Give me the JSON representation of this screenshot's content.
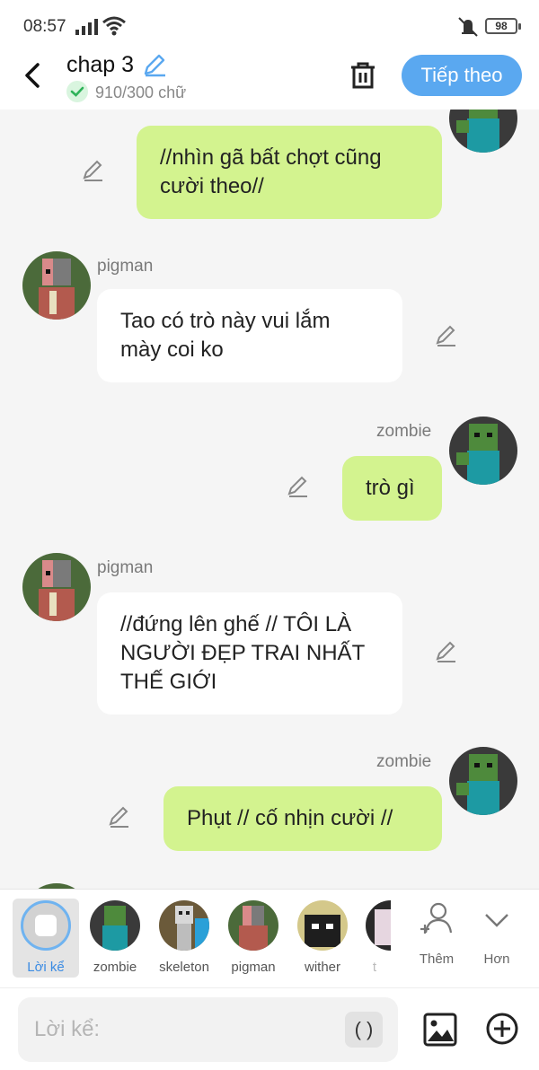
{
  "status_bar": {
    "time": "08:57",
    "battery": "98"
  },
  "header": {
    "title": "chap 3",
    "word_count": "910/300 chữ",
    "next_label": "Tiếp theo"
  },
  "messages": [
    {
      "side": "right",
      "sender": "",
      "text_lines": [
        "//nhìn gã bất chợt cũng",
        "cười theo//"
      ]
    },
    {
      "side": "left",
      "sender": "pigman",
      "text_lines": [
        "Tao có trò này vui lắm",
        "mày coi ko"
      ]
    },
    {
      "side": "right",
      "sender": "zombie",
      "text_lines": [
        "trò gì"
      ]
    },
    {
      "side": "left",
      "sender": "pigman",
      "text_lines": [
        "//đứng lên ghế // TÔI LÀ",
        "NGƯỜI ĐẸP TRAI NHẤT",
        "THẾ GIỚI"
      ]
    },
    {
      "side": "right",
      "sender": "zombie",
      "text_lines": [
        "Phụt // cố nhịn cười //"
      ]
    }
  ],
  "characters": [
    {
      "name": "Lời kể",
      "selected": true,
      "icon": "narrator-icon"
    },
    {
      "name": "zombie",
      "icon": "zombie-avatar"
    },
    {
      "name": "skeleton",
      "icon": "skeleton-avatar"
    },
    {
      "name": "pigman",
      "icon": "pigman-avatar"
    },
    {
      "name": "wither",
      "icon": "wither-avatar"
    },
    {
      "name": "t",
      "icon": "partial-avatar"
    }
  ],
  "tools": {
    "add_label": "Thêm",
    "more_label": "Hơn"
  },
  "composer": {
    "placeholder": "Lời kể:",
    "paren_label": "( )"
  },
  "colors": {
    "accent": "#5aa8f0",
    "right_bubble": "#d3f38f",
    "left_bubble": "#ffffff",
    "background": "#f5f5f5"
  }
}
